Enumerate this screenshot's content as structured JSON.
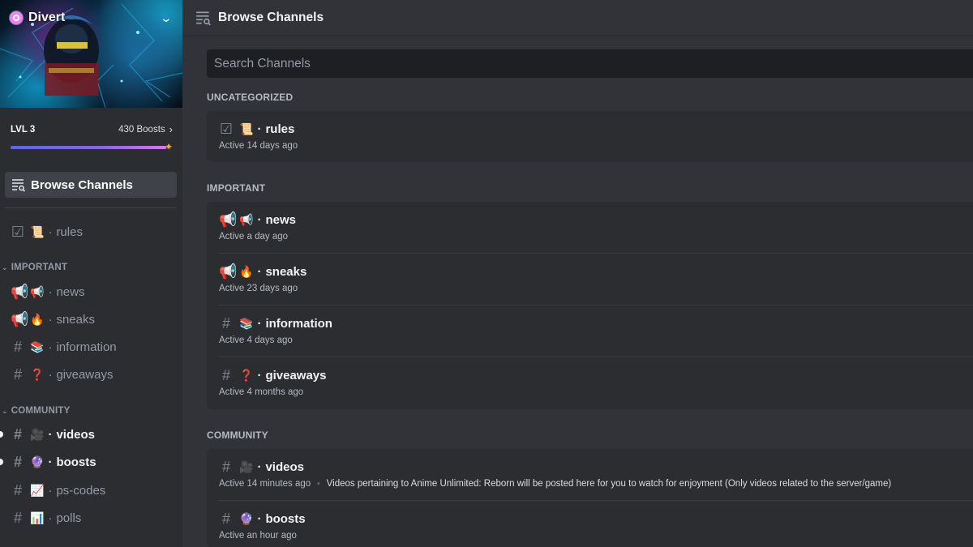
{
  "server": {
    "name": "Divert",
    "level": "LVL 3",
    "boosts": "430 Boosts",
    "boost_progress": 0.97
  },
  "sidebar": {
    "browse_label": "Browse Channels",
    "uncategorized": [
      {
        "icon": "rules-checkbox-icon",
        "emoji": "📜",
        "name": "rules",
        "unread": false
      }
    ],
    "categories": [
      {
        "name": "IMPORTANT",
        "channels": [
          {
            "icon": "announcement-icon",
            "emoji": "📢",
            "name": "news",
            "unread": false
          },
          {
            "icon": "announcement-icon",
            "emoji": "🔥",
            "name": "sneaks",
            "unread": false
          },
          {
            "icon": "hashtag-icon",
            "emoji": "📚",
            "name": "information",
            "unread": false
          },
          {
            "icon": "hashtag-icon",
            "emoji": "❓",
            "name": "giveaways",
            "unread": false
          }
        ]
      },
      {
        "name": "COMMUNITY",
        "channels": [
          {
            "icon": "hashtag-icon",
            "emoji": "🎥",
            "name": "videos",
            "unread": true
          },
          {
            "icon": "hashtag-icon",
            "emoji": "🔮",
            "name": "boosts",
            "unread": true
          },
          {
            "icon": "hashtag-icon",
            "emoji": "📈",
            "name": "ps-codes",
            "unread": false
          },
          {
            "icon": "hashtag-icon",
            "emoji": "📊",
            "name": "polls",
            "unread": false
          }
        ]
      }
    ]
  },
  "main": {
    "title": "Browse Channels",
    "search_placeholder": "Search Channels",
    "sections": [
      {
        "label": "UNCATEGORIZED",
        "channels": [
          {
            "icon": "rules-checkbox-icon",
            "emoji": "📜",
            "name": "rules",
            "activity": "Active 14 days ago",
            "topic": ""
          }
        ]
      },
      {
        "label": "IMPORTANT",
        "channels": [
          {
            "icon": "announcement-icon",
            "emoji": "📢",
            "name": "news",
            "activity": "Active a day ago",
            "topic": ""
          },
          {
            "icon": "announcement-icon",
            "emoji": "🔥",
            "name": "sneaks",
            "activity": "Active 23 days ago",
            "topic": ""
          },
          {
            "icon": "hashtag-icon",
            "emoji": "📚",
            "name": "information",
            "activity": "Active 4 days ago",
            "topic": ""
          },
          {
            "icon": "hashtag-icon",
            "emoji": "❓",
            "name": "giveaways",
            "activity": "Active 4 months ago",
            "topic": ""
          }
        ]
      },
      {
        "label": "COMMUNITY",
        "channels": [
          {
            "icon": "hashtag-icon",
            "emoji": "🎥",
            "name": "videos",
            "activity": "Active 14 minutes ago",
            "topic": "Videos pertaining to Anime Unlimited: Reborn will be posted here for you to watch for enjoyment (Only videos related to the server/game)"
          },
          {
            "icon": "hashtag-icon",
            "emoji": "🔮",
            "name": "boosts",
            "activity": "Active an hour ago",
            "topic": ""
          }
        ]
      }
    ]
  },
  "colors": {
    "background": "#313338",
    "sidebar": "#2b2d31",
    "card": "#2b2d31",
    "search": "#1e1f22",
    "accent": "#5865f2",
    "boost_pink": "#f47fff"
  }
}
